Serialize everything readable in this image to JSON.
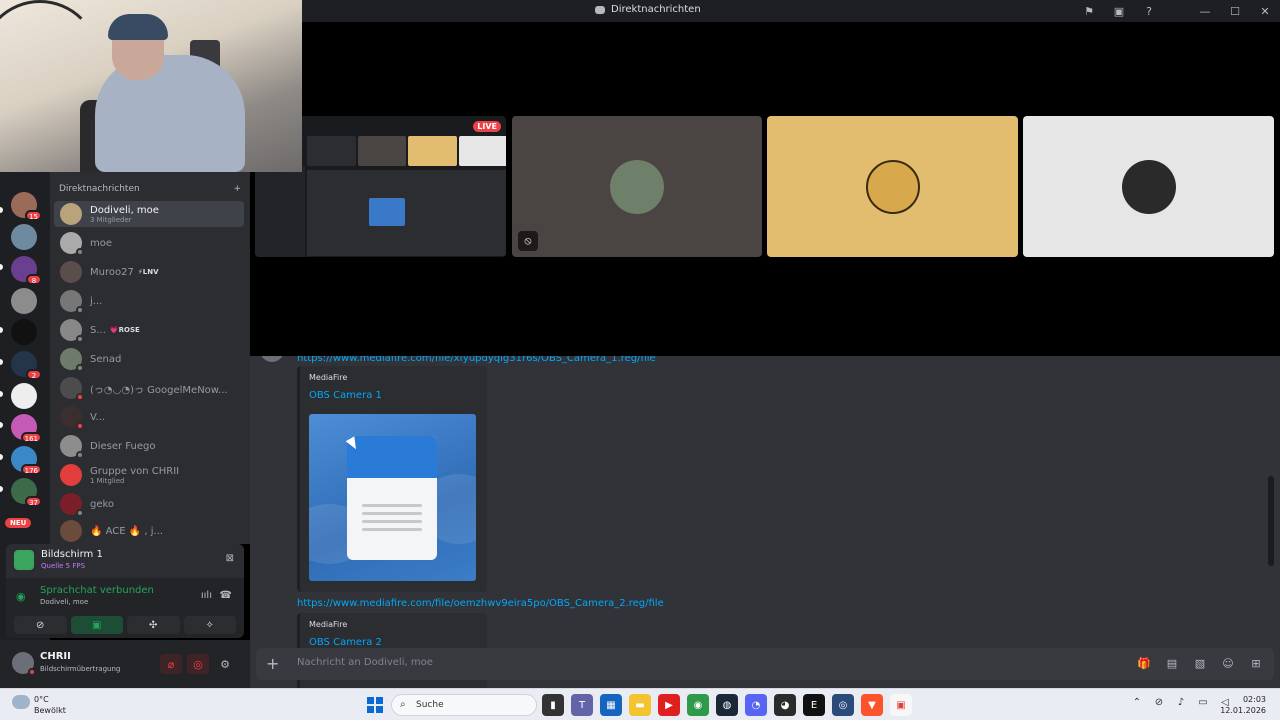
{
  "window": {
    "title": "Direktnachrichten"
  },
  "stage": {
    "live_badge": "LIVE",
    "tiles": [
      {
        "kind": "screen-share",
        "live": true
      },
      {
        "kind": "user",
        "color": "#4a4542",
        "muted_video": true
      },
      {
        "kind": "user",
        "color": "#e2bd6f",
        "muted_video": false
      },
      {
        "kind": "user",
        "color": "#e6e6e6",
        "muted_video": false
      }
    ]
  },
  "servers": [
    {
      "badge": "15"
    },
    {
      "badge": ""
    },
    {
      "badge": "8"
    },
    {
      "badge": ""
    },
    {
      "badge": ""
    },
    {
      "badge": "2"
    },
    {
      "badge": ""
    },
    {
      "badge": "161"
    },
    {
      "badge": "176"
    },
    {
      "badge": "37"
    }
  ],
  "servers_new_label": "NEU",
  "dm_header": {
    "title": "Direktnachrichten",
    "add": "+"
  },
  "dms": [
    {
      "name": "Dodiveli, moe",
      "sub": "3 Mitglieder",
      "active": true,
      "tag": ""
    },
    {
      "name": "moe",
      "sub": "",
      "active": false,
      "tag": ""
    },
    {
      "name": "Muroo27",
      "sub": "",
      "active": false,
      "tag": "LNV"
    },
    {
      "name": "j...",
      "sub": "",
      "active": false,
      "tag": ""
    },
    {
      "name": "S...",
      "sub": "",
      "active": false,
      "tag": "ROSE"
    },
    {
      "name": "Senad",
      "sub": "",
      "active": false,
      "tag": ""
    },
    {
      "name": "(っ◔◡◔)っ GoogelMeNow...",
      "sub": "",
      "active": false,
      "tag": ""
    },
    {
      "name": "V...",
      "sub": "",
      "active": false,
      "tag": ""
    },
    {
      "name": "Dieser Fuego",
      "sub": "",
      "active": false,
      "tag": ""
    },
    {
      "name": "Gruppe von CHRII",
      "sub": "1 Mitglied",
      "active": false,
      "tag": ""
    },
    {
      "name": "geko",
      "sub": "",
      "active": false,
      "tag": ""
    },
    {
      "name": "🔥 ACE 🔥 , j...",
      "sub": "",
      "active": false,
      "tag": ""
    }
  ],
  "stream_panel": {
    "title": "Bildschirm 1",
    "subtitle": "Quelle 5 FPS"
  },
  "voice_panel": {
    "status": "Sprachchat verbunden",
    "channel": "Dodiveli, moe"
  },
  "user": {
    "name": "CHRII",
    "status": "Bildschirmübertragung"
  },
  "chat": {
    "link1": "https://www.mediafire.com/file/xfyupdyqlg31r6s/OBS_Camera_1.reg/file",
    "embed1": {
      "provider": "MediaFire",
      "title": "OBS Camera 1"
    },
    "link2": "https://www.mediafire.com/file/oemzhwv9eira5po/OBS_Camera_2.reg/file",
    "embed2": {
      "provider": "MediaFire",
      "title": "OBS Camera 2"
    }
  },
  "composer": {
    "placeholder": "Nachricht an Dodiveli, moe"
  },
  "taskbar": {
    "weather_temp": "0°C",
    "weather_desc": "Bewölkt",
    "search_label": "Suche",
    "time": "02:03",
    "date": "12.01.2026"
  }
}
